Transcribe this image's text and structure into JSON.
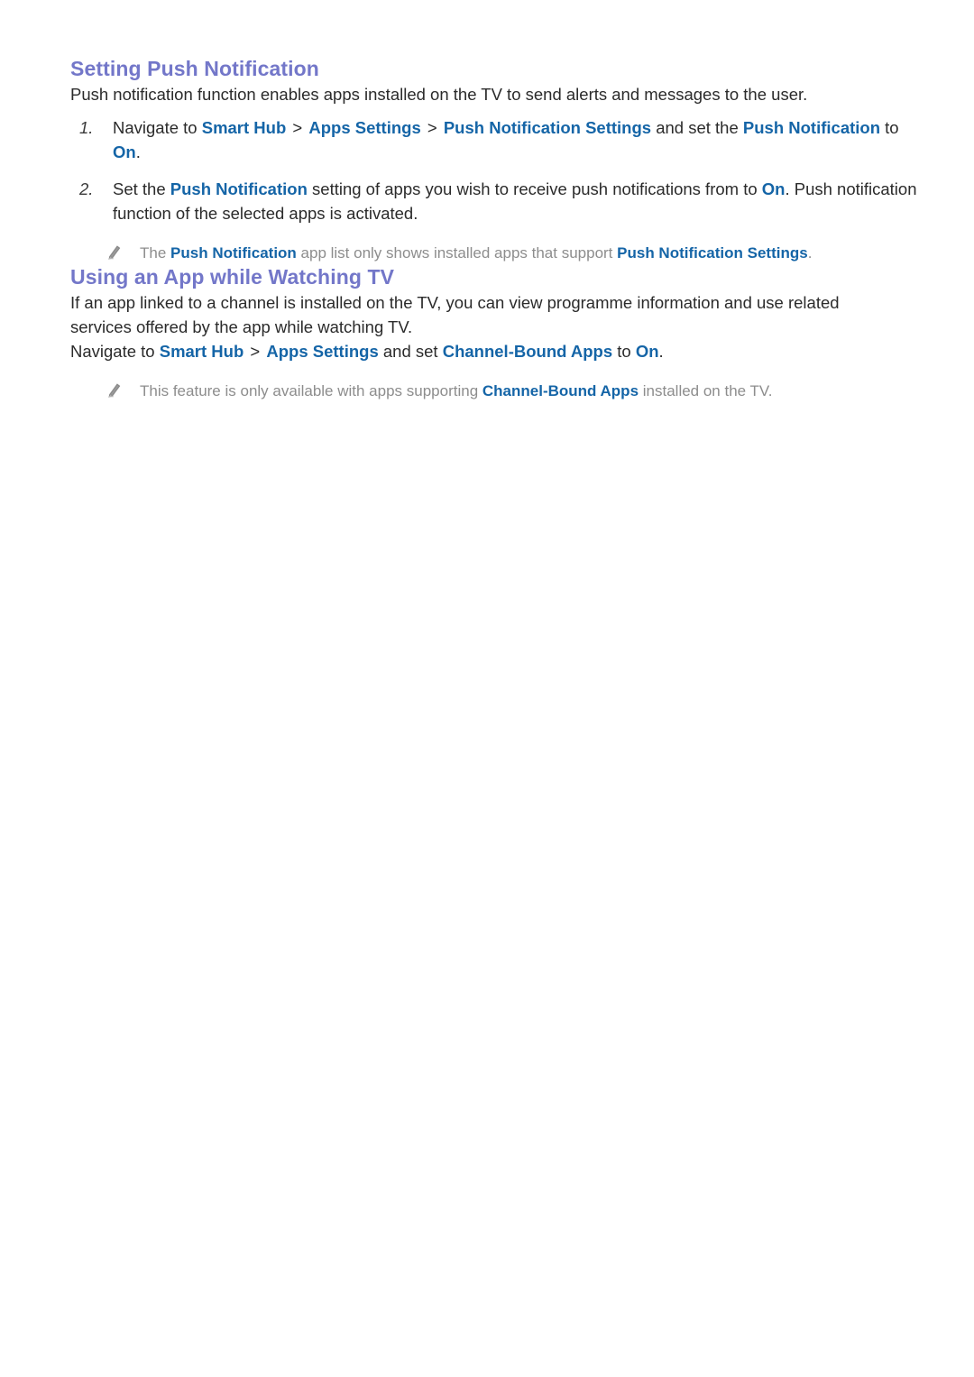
{
  "document": {
    "sections": [
      {
        "heading": "Setting Push Notification",
        "intro": "Push notification function enables apps installed on the TV to send alerts and messages to the user.",
        "steps": [
          {
            "number": "1.",
            "parts": [
              {
                "text": "Navigate to ",
                "style": "plain"
              },
              {
                "text": "Smart Hub",
                "style": "link"
              },
              {
                "text": " > ",
                "style": "sep"
              },
              {
                "text": "Apps Settings",
                "style": "link"
              },
              {
                "text": " > ",
                "style": "sep"
              },
              {
                "text": "Push Notification Settings",
                "style": "link"
              },
              {
                "text": " and set the ",
                "style": "plain"
              },
              {
                "text": "Push Notification",
                "style": "link"
              },
              {
                "text": " to ",
                "style": "plain"
              },
              {
                "text": "On",
                "style": "link"
              },
              {
                "text": ".",
                "style": "plain"
              }
            ]
          },
          {
            "number": "2.",
            "parts": [
              {
                "text": "Set the ",
                "style": "plain"
              },
              {
                "text": "Push Notification",
                "style": "link"
              },
              {
                "text": " setting of apps you wish to receive push notifications from to ",
                "style": "plain"
              },
              {
                "text": "On",
                "style": "link"
              },
              {
                "text": ". Push notification function of the selected apps is activated.",
                "style": "plain"
              }
            ]
          }
        ],
        "note": {
          "icon": "pencil-icon",
          "parts": [
            {
              "text": "The ",
              "style": "plain"
            },
            {
              "text": "Push Notification",
              "style": "link"
            },
            {
              "text": " app list only shows installed apps that support ",
              "style": "plain"
            },
            {
              "text": "Push Notification Settings",
              "style": "link"
            },
            {
              "text": ".",
              "style": "plain"
            }
          ]
        }
      },
      {
        "heading": "Using an App while Watching TV",
        "intro": "If an app linked to a channel is installed on the TV, you can view programme information and use related services offered by the app while watching TV.",
        "navigate": {
          "parts": [
            {
              "text": "Navigate to ",
              "style": "plain"
            },
            {
              "text": "Smart Hub",
              "style": "link"
            },
            {
              "text": " > ",
              "style": "sep"
            },
            {
              "text": "Apps Settings",
              "style": "link"
            },
            {
              "text": " and set ",
              "style": "plain"
            },
            {
              "text": "Channel-Bound Apps",
              "style": "link"
            },
            {
              "text": " to ",
              "style": "plain"
            },
            {
              "text": "On",
              "style": "link"
            },
            {
              "text": ".",
              "style": "plain"
            }
          ]
        },
        "note": {
          "icon": "pencil-icon",
          "parts": [
            {
              "text": "This feature is only available with apps supporting ",
              "style": "plain"
            },
            {
              "text": "Channel-Bound Apps",
              "style": "link"
            },
            {
              "text": " installed on the TV.",
              "style": "plain"
            }
          ]
        }
      }
    ],
    "colors": {
      "heading": "#7377c9",
      "link": "#1565a7",
      "body": "#2b2b2b",
      "note": "#8d8d8d",
      "background": "#ffffff"
    }
  }
}
